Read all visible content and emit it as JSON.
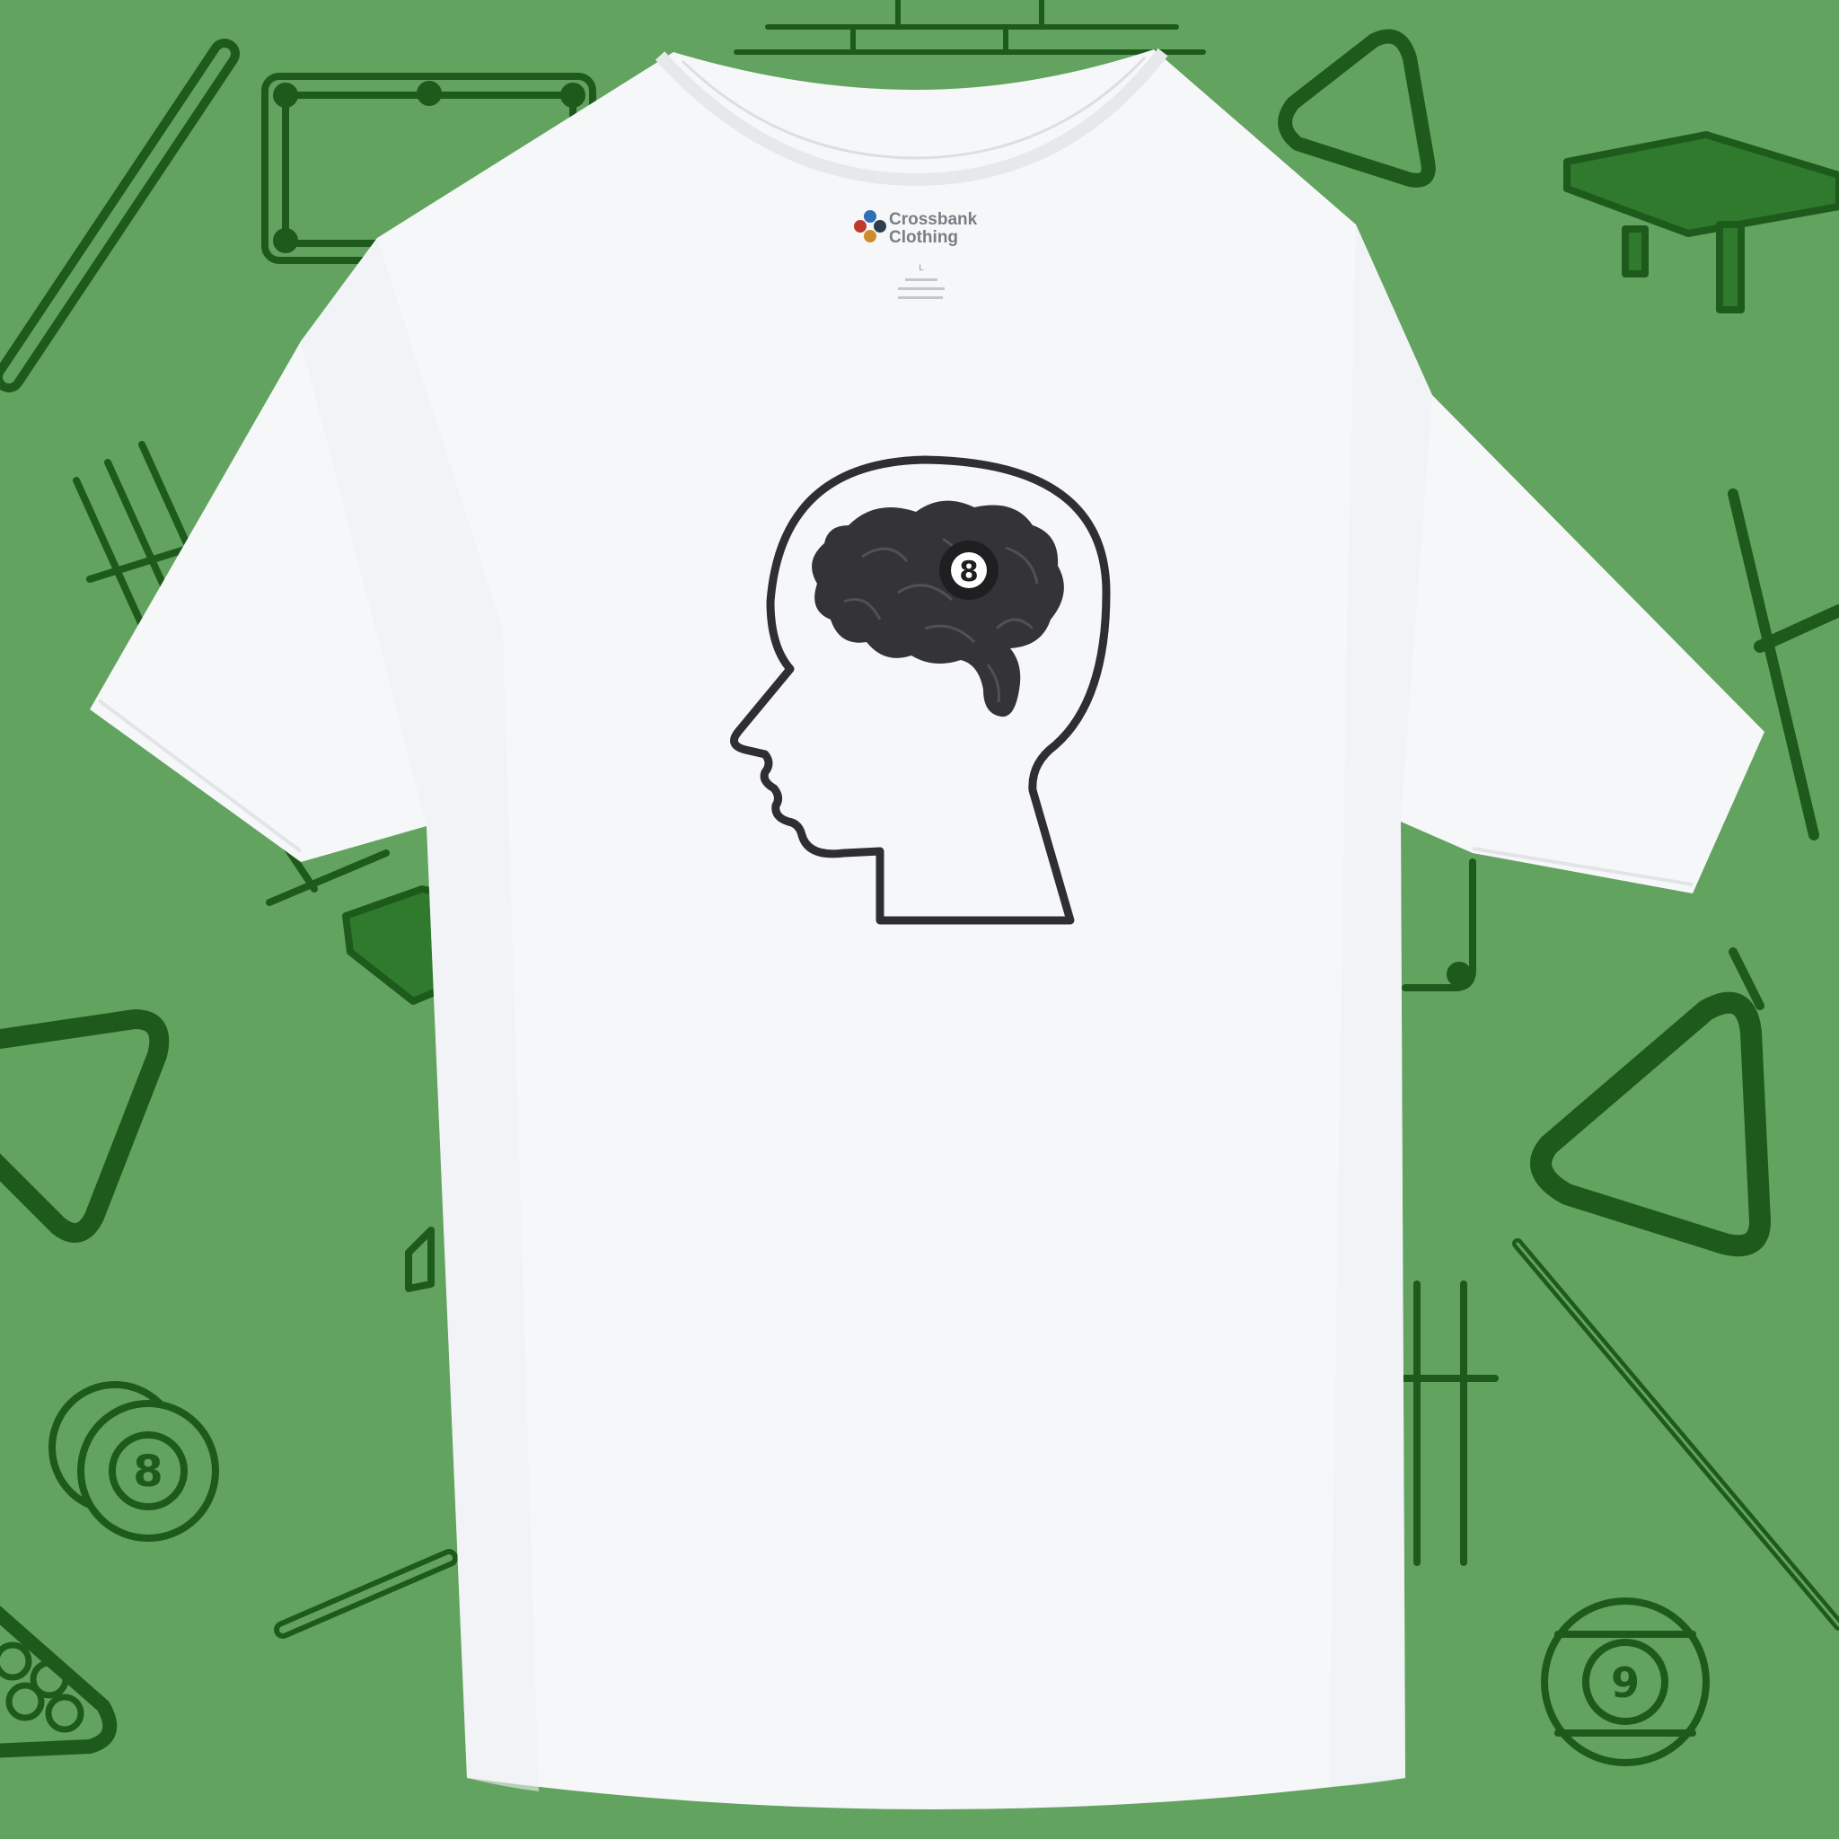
{
  "scene": {
    "background_color": "#62a35f",
    "pattern_color": "#1e5a1c",
    "pattern_fill": "#2f7a2d",
    "shirt_color": "#f6f7f9",
    "ink_color": "#2f2f31"
  },
  "tag": {
    "brand_line1": "Crossbank",
    "brand_line2": "Clothing",
    "size": "L"
  },
  "print": {
    "ball_number": "8"
  },
  "background_balls": {
    "eight": "8",
    "nine": "9"
  }
}
